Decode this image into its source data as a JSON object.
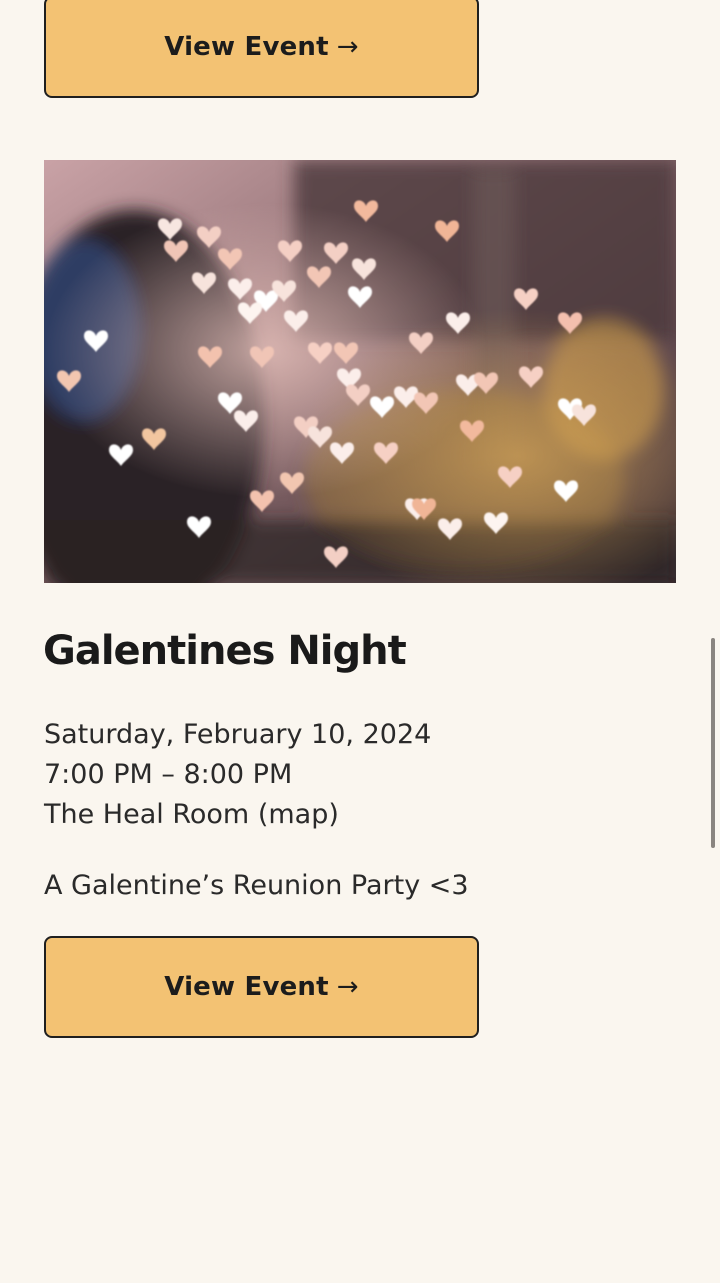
{
  "events": [
    {
      "button_label": "View Event",
      "button_arrow": "→"
    },
    {
      "image_icon": "hearts-bokeh-photo",
      "title": "Galentines Night",
      "date": "Saturday, February 10, 2024",
      "time": "7:00 PM – 8:00 PM",
      "location_name": "The Heal Room",
      "location_link": "(map)",
      "description": "A Galentine’s Reunion Party <3",
      "button_label": "View Event",
      "button_arrow": "→"
    }
  ],
  "colors": {
    "background": "#faf6ef",
    "button": "#f3c273",
    "text": "#1c1c1c"
  }
}
